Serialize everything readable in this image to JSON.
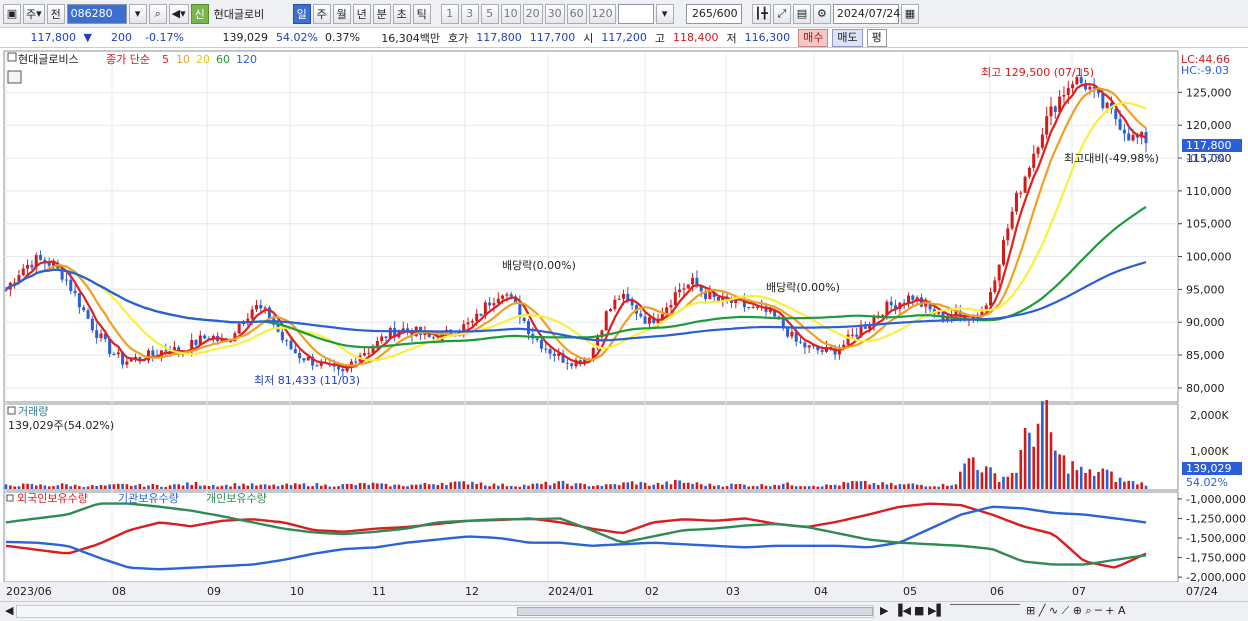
{
  "toolbar": {
    "market_label": "주",
    "prev_label": "전",
    "code_value": "086280",
    "new_badge": "신",
    "stock_name": "현대글로비",
    "periods": [
      "일",
      "주",
      "월",
      "년",
      "분",
      "초",
      "틱"
    ],
    "active_period": "일",
    "intervals": [
      "1",
      "3",
      "5",
      "10",
      "20",
      "30",
      "60",
      "120"
    ],
    "count_value": "265/600",
    "date_value": "2024/07/24"
  },
  "info": {
    "price": "117,800",
    "change": "200",
    "change_pct": "-0.17%",
    "volume": "139,029",
    "volume_ratio": "54.02%",
    "turnover": "0.37%",
    "amount": "16,304백만",
    "bid_label": "호가",
    "ask_price": "117,800",
    "bid_price": "117,700",
    "open_label": "시",
    "open": "117,200",
    "high_label": "고",
    "high": "118,400",
    "low_label": "저",
    "low": "116,300",
    "buy_label": "매수",
    "sell_label": "매도",
    "flat_label": "평"
  },
  "price_panel": {
    "name": "현대글로비스",
    "ma_label": "종가 단순",
    "ma_periods": [
      "5",
      "10",
      "20",
      "60",
      "120"
    ],
    "ma_colors": [
      "#e01f1f",
      "#f0a020",
      "#f8f040",
      "#1d9a3a",
      "#2a5fd8"
    ],
    "lc": "LC:44.66",
    "hc": "HC:-9.03",
    "current_tag": "117,800",
    "current_change": "-0.17%",
    "high_note": "최고 129,500 (07/15)",
    "low_note": "최저 81,433 (11/03)",
    "drop_note": "최고대비(-49.98%)",
    "dividend1": "배당락(0.00%)",
    "dividend2": "배당락(0.00%)",
    "y_ticks": [
      "125,000",
      "120,000",
      "115,000",
      "110,000",
      "105,000",
      "100,000",
      "95,000",
      "90,000",
      "85,000",
      "80,000"
    ]
  },
  "volume_panel": {
    "title": "거래량",
    "summary": "139,029주(54.02%)",
    "y_ticks": [
      "2,000K",
      "1,000K"
    ],
    "current_tag": "139,029",
    "current_ratio": "54.02%"
  },
  "holders_panel": {
    "legend": [
      "외국인보유수량",
      "기관보유수량",
      "개인보유수량"
    ],
    "colors": [
      "#d81e1e",
      "#2b63d8",
      "#2e8b57"
    ],
    "y_ticks": [
      "-1,000,000",
      "-1,250,000",
      "-1,500,000",
      "-1,750,000",
      "-2,000,000"
    ]
  },
  "x_axis": {
    "labels": [
      "2023/06",
      "08",
      "09",
      "10",
      "11",
      "12",
      "2024/01",
      "02",
      "03",
      "04",
      "05",
      "06",
      "07"
    ],
    "right_label": "07/24"
  },
  "chart_data": {
    "type": "candlestick",
    "x_start": "2023/06",
    "x_end": "2024/07/24",
    "price_ylim": [
      78000,
      131000
    ],
    "volume_ylim": [
      0,
      2200000
    ],
    "holders_ylim": [
      -2050000,
      -950000
    ],
    "close_path": [
      95000,
      98000,
      99500,
      99000,
      97000,
      93000,
      89000,
      86000,
      84000,
      84500,
      85000,
      86000,
      85500,
      87000,
      88000,
      86500,
      90000,
      92500,
      91000,
      87000,
      85000,
      84000,
      83000,
      82000,
      85000,
      86000,
      88000,
      89000,
      88500,
      87500,
      88000,
      89000,
      90000,
      93000,
      95000,
      92000,
      88000,
      86000,
      84500,
      84000,
      85000,
      91000,
      94000,
      92000,
      90000,
      92000,
      95000,
      96000,
      94000,
      93000,
      93000,
      92000,
      91500,
      90000,
      87000,
      86000,
      85500,
      86000,
      88000,
      90000,
      92000,
      93000,
      94000,
      92000,
      91000,
      91000,
      91000,
      92000,
      100000,
      108000,
      114000,
      120000,
      124000,
      127000,
      126000,
      123000,
      121000,
      118000,
      117800
    ],
    "volume_path": [
      95000,
      110000,
      105000,
      90000,
      120000,
      85000,
      80000,
      90000,
      110000,
      95000,
      100000,
      85000,
      120000,
      140000,
      110000,
      95000,
      130000,
      105000,
      90000,
      100000,
      115000,
      125000,
      95000,
      105000,
      120000,
      140000,
      100000,
      95000,
      110000,
      130000,
      180000,
      150000,
      200000,
      120000,
      105000,
      90000,
      110000,
      140000,
      160000,
      120000,
      100000,
      95000,
      130000,
      180000,
      120000,
      140000,
      190000,
      150000,
      110000,
      100000,
      120000,
      95000,
      105000,
      140000,
      110000,
      100000,
      90000,
      120000,
      180000,
      150000,
      130000,
      110000,
      125000,
      100000,
      95000,
      160000,
      900000,
      500000,
      300000,
      420000,
      1500000,
      1950000,
      800000,
      600000,
      380000,
      500000,
      260000,
      180000,
      139029
    ],
    "volume_bars": 265,
    "foreign_path": [
      -1600000,
      -1650000,
      -1700000,
      -1580000,
      -1400000,
      -1300000,
      -1350000,
      -1280000,
      -1260000,
      -1300000,
      -1400000,
      -1420000,
      -1380000,
      -1360000,
      -1320000,
      -1280000,
      -1270000,
      -1250000,
      -1300000,
      -1380000,
      -1440000,
      -1300000,
      -1260000,
      -1280000,
      -1250000,
      -1320000,
      -1360000,
      -1290000,
      -1200000,
      -1100000,
      -1060000,
      -1080000,
      -1200000,
      -1350000,
      -1450000,
      -1800000,
      -1880000,
      -1700000
    ],
    "institution_path": [
      -1550000,
      -1560000,
      -1600000,
      -1750000,
      -1880000,
      -1900000,
      -1880000,
      -1860000,
      -1840000,
      -1780000,
      -1700000,
      -1640000,
      -1620000,
      -1560000,
      -1520000,
      -1480000,
      -1500000,
      -1560000,
      -1560000,
      -1600000,
      -1580000,
      -1560000,
      -1580000,
      -1600000,
      -1620000,
      -1600000,
      -1600000,
      -1600000,
      -1620000,
      -1560000,
      -1380000,
      -1200000,
      -1100000,
      -1120000,
      -1180000,
      -1200000,
      -1250000,
      -1300000
    ],
    "individual_path": [
      -1300000,
      -1250000,
      -1200000,
      -1060000,
      -1060000,
      -1100000,
      -1150000,
      -1220000,
      -1300000,
      -1380000,
      -1430000,
      -1450000,
      -1420000,
      -1380000,
      -1300000,
      -1280000,
      -1260000,
      -1260000,
      -1250000,
      -1400000,
      -1560000,
      -1480000,
      -1400000,
      -1380000,
      -1340000,
      -1320000,
      -1360000,
      -1440000,
      -1520000,
      -1560000,
      -1580000,
      -1600000,
      -1640000,
      -1800000,
      -1840000,
      -1840000,
      -1780000,
      -1720000
    ]
  }
}
